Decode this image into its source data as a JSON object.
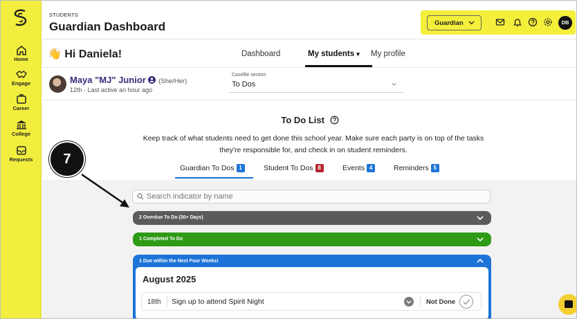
{
  "sidebar": {
    "items": [
      {
        "label": "Home",
        "icon": "home-icon"
      },
      {
        "label": "Engage",
        "icon": "engage-icon"
      },
      {
        "label": "Career",
        "icon": "briefcase-icon"
      },
      {
        "label": "College",
        "icon": "college-icon"
      },
      {
        "label": "Requests",
        "icon": "requests-icon"
      }
    ]
  },
  "header": {
    "eyebrow": "STUDENTS",
    "title": "Guardian Dashboard",
    "role_select": "Guardian",
    "avatar_initials": "DB"
  },
  "greeting": {
    "emoji": "👋",
    "text": "Hi Daniela!"
  },
  "main_tabs": [
    {
      "label": "Dashboard",
      "active": false
    },
    {
      "label": "My students",
      "active": true,
      "caret": "▾"
    },
    {
      "label": "My profile",
      "active": false
    }
  ],
  "student": {
    "name": "Maya \"MJ\" Junior",
    "pronouns": "(She/Her)",
    "subtitle": "12th - Last active an hour ago"
  },
  "casefile": {
    "label": "Casefile section",
    "value": "To Dos"
  },
  "todo": {
    "title": "To Do List",
    "description": "Keep track of what students need to get done this school year. Make sure each party is on top of the tasks they're responsible for, and check in on student reminders."
  },
  "sub_tabs": [
    {
      "label": "Guardian To Dos",
      "count": "1",
      "color": "#1d74d8",
      "active": true
    },
    {
      "label": "Student To Dos",
      "count": "8",
      "color": "#b3262e",
      "active": false
    },
    {
      "label": "Events",
      "count": "4",
      "color": "#1d74d8",
      "active": false
    },
    {
      "label": "Reminders",
      "count": "5",
      "color": "#1d74d8",
      "active": false
    }
  ],
  "search": {
    "placeholder": "Search indicator by name"
  },
  "groups": [
    {
      "label": "2 Overdue To Do (30+ Days)",
      "color": "#5b5b5b",
      "expanded": false
    },
    {
      "label": "1 Completed To Do",
      "color": "#2e9a16",
      "expanded": false
    },
    {
      "label": "1 Due within the Next Four Weeks!",
      "color": "#1d74d8",
      "expanded": true
    }
  ],
  "due_group": {
    "month": "August 2025",
    "tasks": [
      {
        "day": "18th",
        "text": "Sign up to attend Spirit Night",
        "status": "Not Done"
      }
    ]
  },
  "annotation": {
    "step": "7"
  },
  "colors": {
    "brand_yellow": "#f2ee3e",
    "accent_blue": "#1d74d8"
  }
}
